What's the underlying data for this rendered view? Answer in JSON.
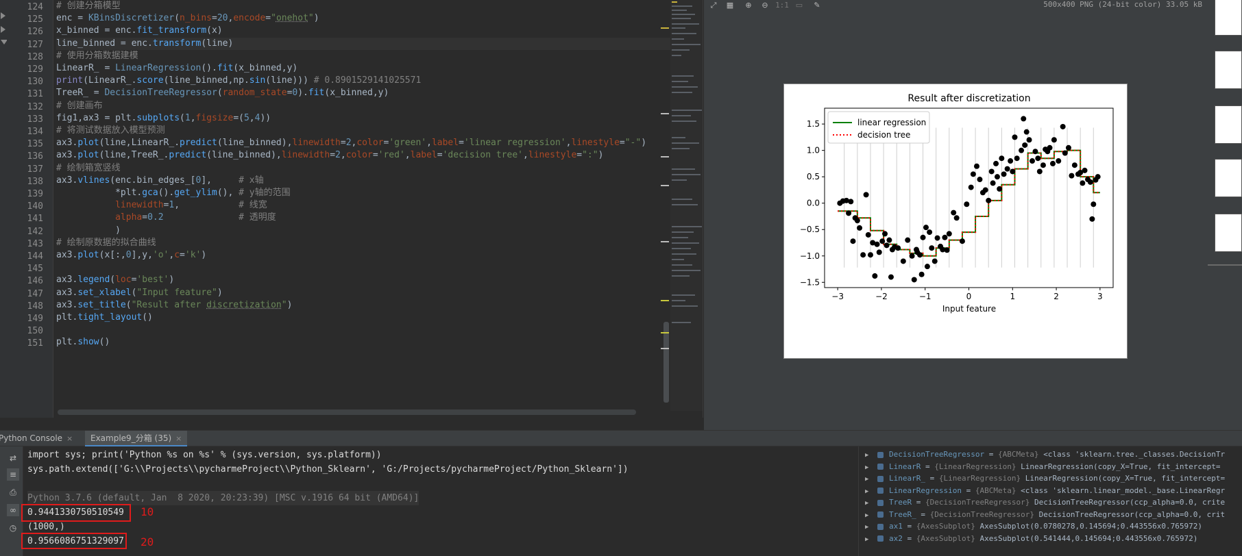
{
  "editor": {
    "lines": [
      {
        "n": "124",
        "text": "# 创建分箱模型"
      },
      {
        "n": "125",
        "text": "enc = KBinsDiscretizer(n_bins=20,encode=\"onehot\")"
      },
      {
        "n": "126",
        "text": "x_binned = enc.fit_transform(x)"
      },
      {
        "n": "127",
        "text": "line_binned = enc.transform(line)"
      },
      {
        "n": "128",
        "text": "# 使用分箱数据建模"
      },
      {
        "n": "129",
        "text": "LinearR_ = LinearRegression().fit(x_binned,y)"
      },
      {
        "n": "130",
        "text": "print(LinearR_.score(line_binned,np.sin(line))) # 0.8901529141025571"
      },
      {
        "n": "131",
        "text": "TreeR_ = DecisionTreeRegressor(random_state=0).fit(x_binned,y)"
      },
      {
        "n": "132",
        "text": "# 创建画布"
      },
      {
        "n": "133",
        "text": "fig1,ax3 = plt.subplots(1,figsize=(5,4))"
      },
      {
        "n": "134",
        "text": "# 将测试数据放入模型预测"
      },
      {
        "n": "135",
        "text": "ax3.plot(line,LinearR_.predict(line_binned),linewidth=2,color='green',label='linear regression',linestyle=\"-\")"
      },
      {
        "n": "136",
        "text": "ax3.plot(line,TreeR_.predict(line_binned),linewidth=2,color='red',label='decision tree',linestyle=\":\")"
      },
      {
        "n": "137",
        "text": "# 绘制箱宽竖线"
      },
      {
        "n": "138",
        "text": "ax3.vlines(enc.bin_edges_[0],     # x轴"
      },
      {
        "n": "139",
        "text": "           *plt.gca().get_ylim(), # y轴的范围"
      },
      {
        "n": "140",
        "text": "           linewidth=1,           # 线宽"
      },
      {
        "n": "141",
        "text": "           alpha=0.2              # 透明度"
      },
      {
        "n": "142",
        "text": "           )"
      },
      {
        "n": "143",
        "text": "# 绘制原数据的拟合曲线"
      },
      {
        "n": "144",
        "text": "ax3.plot(x[:,0],y,'o',c='k')"
      },
      {
        "n": "145",
        "text": ""
      },
      {
        "n": "146",
        "text": "ax3.legend(loc='best')"
      },
      {
        "n": "147",
        "text": "ax3.set_xlabel(\"Input feature\")"
      },
      {
        "n": "148",
        "text": "ax3.set_title(\"Result after discretization\")"
      },
      {
        "n": "149",
        "text": "plt.tight_layout()"
      },
      {
        "n": "150",
        "text": ""
      },
      {
        "n": "151",
        "text": "plt.show()"
      }
    ],
    "current_line": "127"
  },
  "viewer": {
    "image_info": "500x400 PNG (24-bit color) 33.05 kB",
    "zoom_label": "1:1",
    "toolbar_icons": [
      "fit-icon",
      "grid-icon",
      "zoom-in-icon",
      "zoom-out-icon",
      "actual-size-icon",
      "background-icon",
      "color-picker-icon"
    ]
  },
  "chart_data": {
    "type": "scatter",
    "title": "Result after discretization",
    "xlabel": "Input feature",
    "ylabel": "",
    "xlim": [
      -3.3,
      3.3
    ],
    "ylim": [
      -1.6,
      1.8
    ],
    "xticks": [
      "−3",
      "−2",
      "−1",
      "0",
      "1",
      "2",
      "3"
    ],
    "yticks": [
      "1.5",
      "1.0",
      "0.5",
      "0.0",
      "−0.5",
      "−1.0",
      "−1.5"
    ],
    "legend_position": "top-left",
    "bin_edges": [
      -2.85,
      -2.55,
      -2.25,
      -1.95,
      -1.65,
      -1.35,
      -1.05,
      -0.75,
      -0.45,
      -0.15,
      0.15,
      0.45,
      0.75,
      1.05,
      1.35,
      1.65,
      1.95,
      2.25,
      2.55,
      2.85
    ],
    "series": [
      {
        "name": "linear regression",
        "color": "#008000",
        "linestyle": "-",
        "steps": [
          -0.15,
          -0.28,
          -0.52,
          -0.78,
          -0.88,
          -0.95,
          -1.0,
          -0.85,
          -0.7,
          -0.55,
          -0.25,
          0.05,
          0.35,
          0.65,
          0.95,
          0.85,
          0.98,
          1.0,
          0.5,
          0.2
        ]
      },
      {
        "name": "decision tree",
        "color": "#ff0000",
        "linestyle": ":",
        "steps": [
          -0.15,
          -0.28,
          -0.52,
          -0.78,
          -0.88,
          -0.95,
          -1.0,
          -0.85,
          -0.7,
          -0.55,
          -0.25,
          0.05,
          0.35,
          0.65,
          0.95,
          0.85,
          0.98,
          1.0,
          0.5,
          0.2
        ]
      }
    ],
    "points": [
      [
        -2.95,
        0.0
      ],
      [
        -2.88,
        0.04
      ],
      [
        -2.8,
        0.05
      ],
      [
        -2.75,
        -0.19
      ],
      [
        -2.7,
        0.03
      ],
      [
        -2.65,
        -0.72
      ],
      [
        -2.6,
        -0.28
      ],
      [
        -2.55,
        -0.33
      ],
      [
        -2.5,
        -0.47
      ],
      [
        -2.42,
        -0.98
      ],
      [
        -2.35,
        0.16
      ],
      [
        -2.3,
        -0.6
      ],
      [
        -2.25,
        -0.98
      ],
      [
        -2.2,
        -0.75
      ],
      [
        -2.15,
        -1.38
      ],
      [
        -2.1,
        -0.78
      ],
      [
        -2.05,
        -0.93
      ],
      [
        -1.98,
        -0.72
      ],
      [
        -1.92,
        -0.58
      ],
      [
        -1.88,
        -0.8
      ],
      [
        -1.82,
        -0.7
      ],
      [
        -1.78,
        -1.4
      ],
      [
        -1.75,
        -0.88
      ],
      [
        -1.7,
        -0.83
      ],
      [
        -1.62,
        -0.85
      ],
      [
        -1.5,
        -1.1
      ],
      [
        -1.4,
        -0.7
      ],
      [
        -1.3,
        -1.0
      ],
      [
        -1.25,
        -1.45
      ],
      [
        -1.2,
        -0.88
      ],
      [
        -1.18,
        -0.93
      ],
      [
        -1.12,
        -0.98
      ],
      [
        -1.08,
        -1.35
      ],
      [
        -1.05,
        -0.65
      ],
      [
        -0.98,
        -0.46
      ],
      [
        -0.95,
        -1.2
      ],
      [
        -0.9,
        -0.55
      ],
      [
        -0.85,
        -0.85
      ],
      [
        -0.78,
        -1.1
      ],
      [
        -0.72,
        -0.66
      ],
      [
        -0.65,
        -0.82
      ],
      [
        -0.6,
        -0.88
      ],
      [
        -0.55,
        -0.65
      ],
      [
        -0.5,
        -0.89
      ],
      [
        -0.45,
        -0.58
      ],
      [
        -0.35,
        -0.18
      ],
      [
        -0.28,
        -0.28
      ],
      [
        -0.15,
        -0.72
      ],
      [
        -0.05,
        -0.02
      ],
      [
        0.05,
        0.3
      ],
      [
        0.1,
        0.55
      ],
      [
        0.18,
        0.7
      ],
      [
        0.25,
        0.45
      ],
      [
        0.32,
        0.2
      ],
      [
        0.38,
        0.25
      ],
      [
        0.45,
        0.05
      ],
      [
        0.52,
        0.6
      ],
      [
        0.55,
        0.38
      ],
      [
        0.62,
        0.75
      ],
      [
        0.65,
        0.5
      ],
      [
        0.7,
        0.27
      ],
      [
        0.75,
        0.85
      ],
      [
        0.8,
        0.55
      ],
      [
        0.88,
        0.65
      ],
      [
        0.95,
        0.8
      ],
      [
        1.0,
        0.6
      ],
      [
        1.05,
        1.25
      ],
      [
        1.1,
        0.85
      ],
      [
        1.2,
        1.0
      ],
      [
        1.25,
        1.6
      ],
      [
        1.28,
        1.1
      ],
      [
        1.32,
        1.35
      ],
      [
        1.38,
        1.2
      ],
      [
        1.45,
        0.8
      ],
      [
        1.52,
        0.98
      ],
      [
        1.58,
        0.85
      ],
      [
        1.62,
        0.6
      ],
      [
        1.7,
        0.72
      ],
      [
        1.75,
        1.02
      ],
      [
        1.8,
        0.98
      ],
      [
        1.85,
        1.05
      ],
      [
        1.92,
        0.75
      ],
      [
        1.95,
        1.2
      ],
      [
        2.05,
        0.8
      ],
      [
        2.15,
        1.45
      ],
      [
        2.2,
        0.95
      ],
      [
        2.28,
        1.05
      ],
      [
        2.35,
        0.52
      ],
      [
        2.42,
        0.72
      ],
      [
        2.5,
        0.55
      ],
      [
        2.55,
        0.58
      ],
      [
        2.6,
        0.38
      ],
      [
        2.65,
        0.62
      ],
      [
        2.72,
        0.45
      ],
      [
        2.78,
        0.4
      ],
      [
        2.82,
        -0.3
      ],
      [
        2.85,
        -0.02
      ],
      [
        2.9,
        0.44
      ],
      [
        2.95,
        0.5
      ]
    ]
  },
  "tabs": {
    "python_console": "Python Console",
    "example": "Example9_分箱 (35)",
    "close": "×"
  },
  "console": {
    "lines": [
      "import sys; print('Python %s on %s' % (sys.version, sys.platform))",
      "sys.path.extend(['G:\\\\Projects\\\\pycharmeProject\\\\Python_Sklearn', 'G:/Projects/pycharmeProject/Python_Sklearn'])",
      "",
      "Python 3.7.6 (default, Jan  8 2020, 20:23:39) [MSC v.1916 64 bit (AMD64)]",
      "0.9441330750510549",
      "(1000,)",
      "0.9566086751329097"
    ],
    "annotation_1": "10",
    "annotation_2": "20"
  },
  "variables": [
    {
      "name": "DecisionTreeRegressor",
      "type": "{ABCMeta}",
      "value": "<class 'sklearn.tree._classes.DecisionTr"
    },
    {
      "name": "LinearR",
      "type": "{LinearRegression}",
      "value": "LinearRegression(copy_X=True, fit_intercept="
    },
    {
      "name": "LinearR_",
      "type": "{LinearRegression}",
      "value": "LinearRegression(copy_X=True, fit_intercept="
    },
    {
      "name": "LinearRegression",
      "type": "{ABCMeta}",
      "value": "<class 'sklearn.linear_model._base.LinearRegr"
    },
    {
      "name": "TreeR",
      "type": "{DecisionTreeRegressor}",
      "value": "DecisionTreeRegressor(ccp_alpha=0.0, crite"
    },
    {
      "name": "TreeR_",
      "type": "{DecisionTreeRegressor}",
      "value": "DecisionTreeRegressor(ccp_alpha=0.0, crit"
    },
    {
      "name": "ax1",
      "type": "{AxesSubplot}",
      "value": "AxesSubplot(0.0780278,0.145694;0.443556x0.765972)"
    },
    {
      "name": "ax2",
      "type": "{AxesSubplot}",
      "value": "AxesSubplot(0.541444,0.145694;0.443556x0.765972)"
    }
  ]
}
